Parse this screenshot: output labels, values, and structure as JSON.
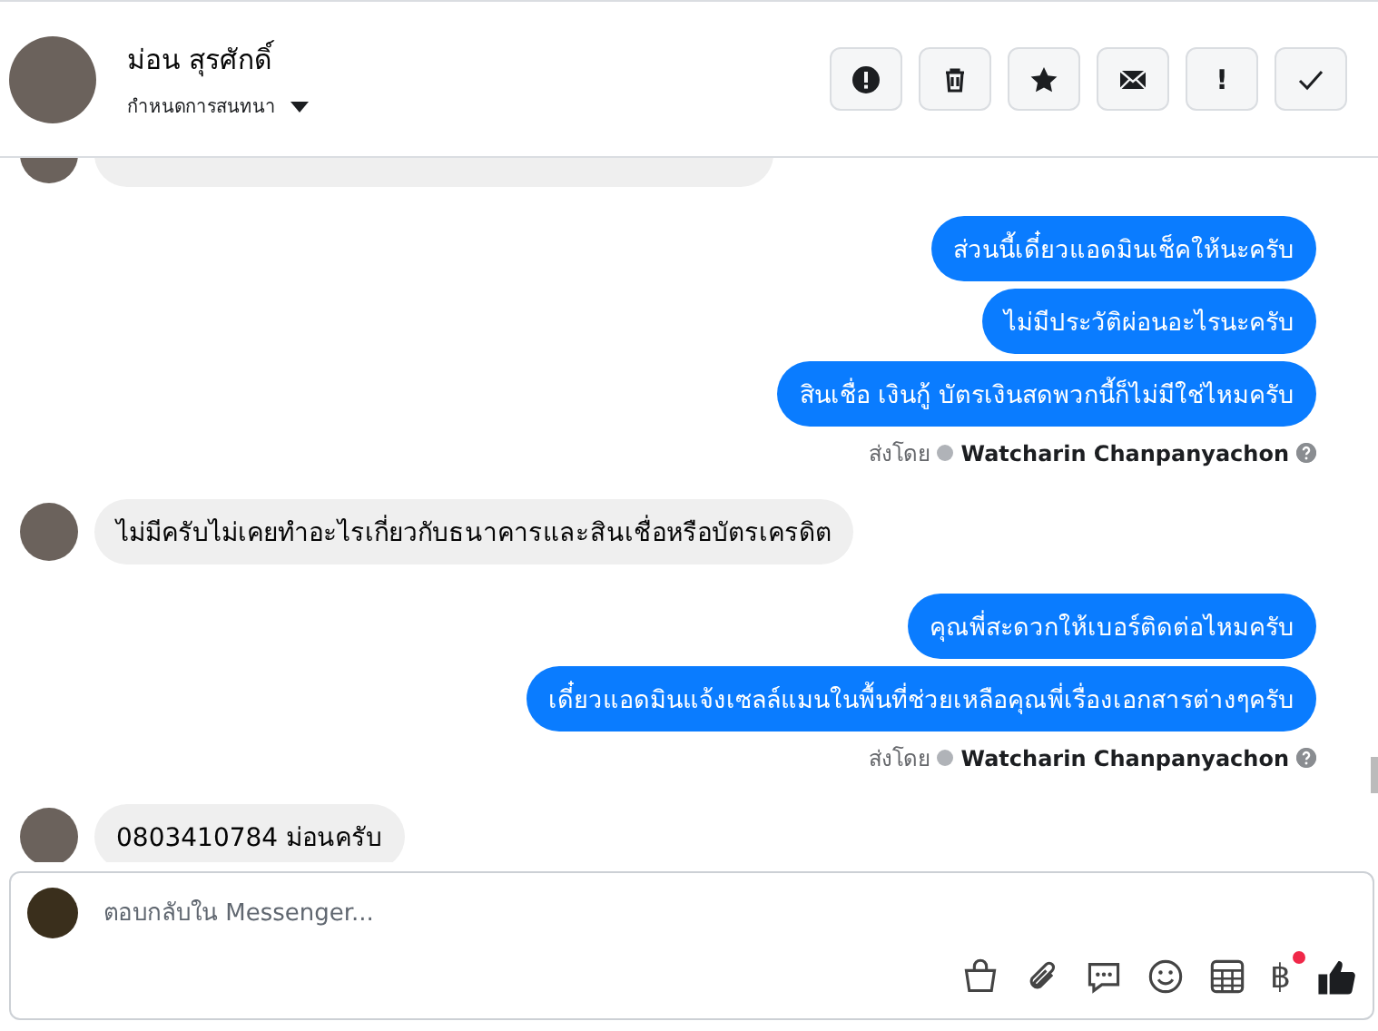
{
  "header": {
    "name": "ม่อน สุรศักดิ์",
    "subtitle": "กำหนดการสนทนา",
    "actions": [
      {
        "kind": "alert"
      },
      {
        "kind": "trash"
      },
      {
        "kind": "star"
      },
      {
        "kind": "mail"
      },
      {
        "kind": "text",
        "label": "!"
      },
      {
        "kind": "check"
      }
    ]
  },
  "messages": [
    {
      "kind": "incoming_cut"
    },
    {
      "kind": "outgoing",
      "text": "ส่วนนี้เดี๋ยวแอดมินเช็คให้นะครับ"
    },
    {
      "kind": "outgoing",
      "text": "ไม่มีประวัติผ่อนอะไรนะครับ"
    },
    {
      "kind": "outgoing",
      "text": "สินเชื่อ เงินกู้ บัตรเงินสดพวกนี้ก็ไม่มีใช่ไหมครับ"
    },
    {
      "kind": "sent_by",
      "label": "ส่งโดย",
      "text": "Watcharin Chanpanyachon"
    },
    {
      "kind": "incoming",
      "text": "ไม่มีครับไม่เคยทำอะไรเกี่ยวกับธนาคารและสินเชื่อหรือบัตรเครดิต"
    },
    {
      "kind": "outgoing",
      "text": "คุณพี่สะดวกให้เบอร์ติดต่อไหมครับ"
    },
    {
      "kind": "outgoing",
      "text": "เดี๋ยวแอดมินแจ้งเซลล์แมนในพื้นที่ช่วยเหลือคุณพี่เรื่องเอกสารต่างๆครับ"
    },
    {
      "kind": "sent_by",
      "label": "ส่งโดย",
      "text": "Watcharin Chanpanyachon"
    },
    {
      "kind": "incoming",
      "text": "0803410784 ม่อนครับ"
    }
  ],
  "composer": {
    "placeholder": "ตอบกลับใน Messenger...",
    "tools": [
      {
        "kind": "bag",
        "notification": false
      },
      {
        "kind": "clip",
        "notification": false
      },
      {
        "kind": "chat",
        "notification": false
      },
      {
        "kind": "smile",
        "notification": false
      },
      {
        "kind": "table",
        "notification": false
      },
      {
        "kind": "baht",
        "label": "฿",
        "notification": true
      },
      {
        "kind": "like",
        "notification": false
      }
    ]
  }
}
